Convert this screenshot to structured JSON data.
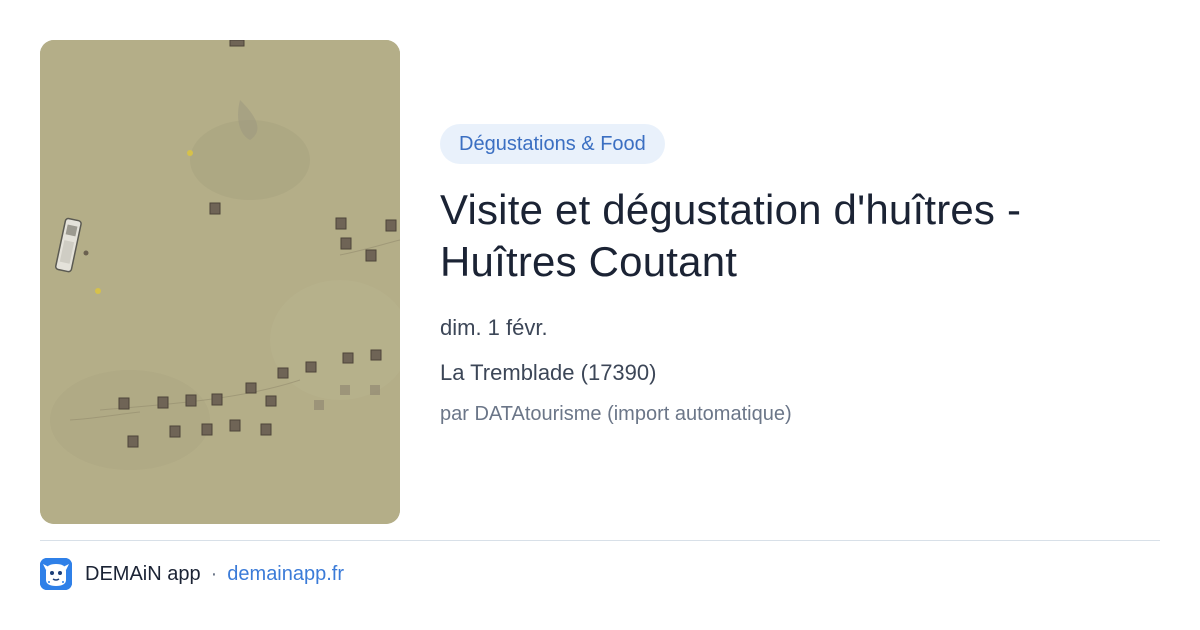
{
  "card": {
    "image_icon": "oyster-farm-aerial-photo",
    "category": "Dégustations & Food",
    "title_line1": "Visite et dégustation d'huîtres -",
    "title_line2": "Huîtres Coutant",
    "date": "dim. 1 févr.",
    "location": "La Tremblade (17390)",
    "source": "par DATAtourisme (import automatique)"
  },
  "footer": {
    "app_icon": "demain-app-logo-icon",
    "app_name": "DEMAiN app",
    "separator": "·",
    "domain": "demainapp.fr"
  },
  "colors": {
    "tag_bg": "#e9f1fb",
    "tag_text": "#3b6fc2",
    "title": "#1b2334",
    "link": "#3b7bd8",
    "water": "#b2ac86"
  }
}
